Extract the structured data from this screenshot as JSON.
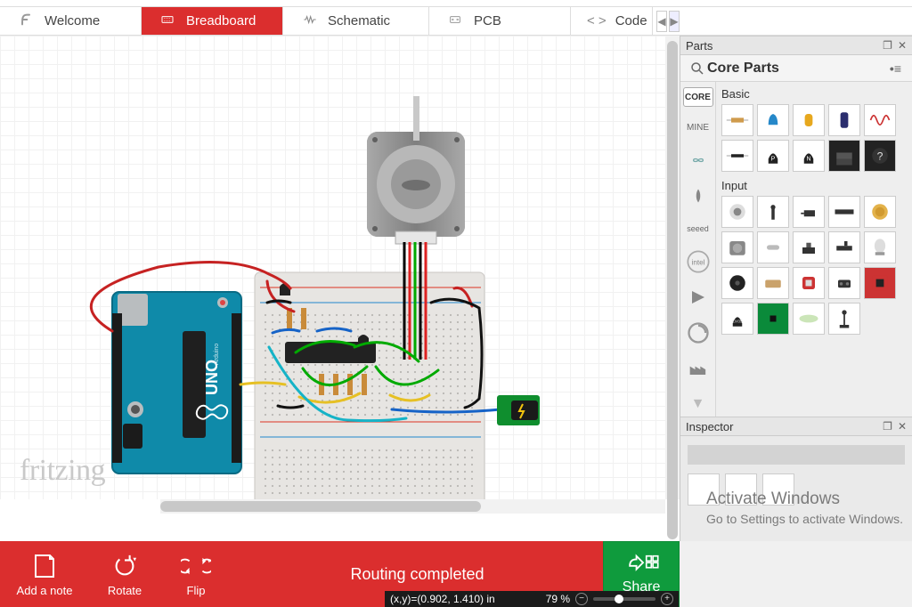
{
  "tabs": {
    "welcome": "Welcome",
    "breadboard": "Breadboard",
    "schematic": "Schematic",
    "pcb": "PCB",
    "code": "Code"
  },
  "watermark": "fritzing",
  "panels": {
    "parts_title": "Parts",
    "core_parts": "Core Parts",
    "basic_label": "Basic",
    "input_label": "Input",
    "inspector_title": "Inspector"
  },
  "bins": {
    "core": "CORE",
    "mine": "MINE",
    "seeed": "seeed"
  },
  "bottombar": {
    "add_note": "Add a note",
    "rotate": "Rotate",
    "flip": "Flip",
    "share": "Share",
    "routing": "Routing completed"
  },
  "status": {
    "coords": "(x,y)=(0.902, 1.410) in",
    "zoom": "79 %"
  },
  "overlay": {
    "line1": "Activate Windows",
    "line2": "Go to Settings to activate Windows."
  }
}
